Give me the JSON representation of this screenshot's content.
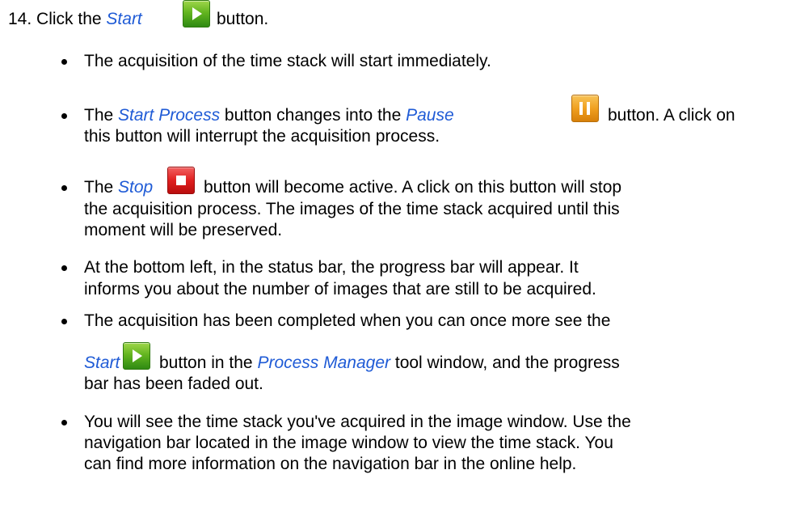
{
  "step": {
    "number": "14.",
    "text_before": "Click the",
    "start_label": "Start",
    "text_after": "button."
  },
  "bullets": {
    "b1": "The acquisition of the time stack will start immediately.",
    "b2": {
      "text1": "The",
      "start_process": "Start Process",
      "text2": "button changes into the",
      "pause": "Pause",
      "text3": "button. A click on",
      "line2": "this button will interrupt the acquisition process."
    },
    "b3": {
      "text1": "The",
      "stop": "Stop",
      "text2": "button will become active. A click on this button will stop",
      "line2": "the acquisition process. The images of the time stack acquired until this",
      "line3": "moment will be preserved."
    },
    "b4": {
      "line1": "At the bottom left, in the status bar, the progress bar will appear. It",
      "line2": "informs you about the number of images that are still to be acquired."
    },
    "b5": {
      "line1": "The acquisition has been completed when you can once more see the",
      "start": "Start",
      "text2": "button in the",
      "process_manager": "Process Manager",
      "text3": "tool window, and the progress",
      "line3": "bar has been faded out."
    },
    "b6": {
      "line1": "You will see the time stack you've acquired in the image window. Use the",
      "line2": "navigation bar located in the image window to view the time stack. You",
      "line3": "can find more information on the navigation bar in the online help."
    }
  },
  "icons": {
    "start": "play-icon",
    "pause": "pause-icon",
    "stop": "stop-icon"
  },
  "colors": {
    "link_text": "#1f5bd6",
    "start_green": "#63b51f",
    "pause_orange": "#f0a021",
    "stop_red": "#e02020"
  }
}
